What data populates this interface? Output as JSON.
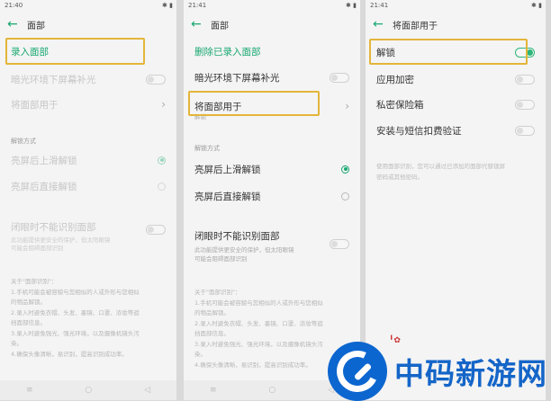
{
  "panel1": {
    "status_left": "21:40 ",
    "status_right": "",
    "title": "面部",
    "rows": {
      "enroll": "录入面部",
      "dim_fill": "暗光环境下屏幕补光",
      "use_face_for": "将面部用于"
    },
    "section_unlock": "解锁方式",
    "unlock_swipe": "亮屏后上滑解锁",
    "unlock_direct": "亮屏后直接解锁",
    "eyes_closed": "闭眼时不能识别面部",
    "eyes_closed_sub_1": "此功能提供更安全的保护，但太阳眼镜",
    "eyes_closed_sub_2": "可能会阻碍面部识别",
    "about_title": "关于\"面部识别\"：",
    "about_lines": [
      "1.手机可能会被容貌与您相似的人或外形与您相似",
      "的物品解锁。",
      "2.录入时避免衣帽、头发、墨镜、口罩、浓妆等遮",
      "挡面部信息。",
      "3.录入时避免强光、强光环境，以及摄像机镜头污",
      "染。",
      "4.确保头像清晰，易识别，提高识别成功率。"
    ]
  },
  "panel2": {
    "status_left": "21:41 ",
    "title": "面部",
    "rows": {
      "delete": "删除已录入面部",
      "dim_fill": "暗光环境下屏幕补光",
      "use_face_for": "将面部用于",
      "use_face_for_sub": "解锁"
    },
    "section_unlock": "解锁方式",
    "unlock_swipe": "亮屏后上滑解锁",
    "unlock_direct": "亮屏后直接解锁",
    "eyes_closed": "闭眼时不能识别面部",
    "eyes_closed_sub_1": "此功能提供更安全的保护，但太阳眼镜",
    "eyes_closed_sub_2": "可能会阻碍面部识别",
    "about_title": "关于\"面部识别\"：",
    "about_lines": [
      "1.手机可能会被容貌与您相似的人或外形与您相似",
      "的物品解锁。",
      "2.录入时避免衣帽、头发、墨镜、口罩、浓妆等遮",
      "挡面部信息。",
      "3.录入时避免强光、强光环境，以及摄像机镜头污",
      "染。",
      "4.确保头像清晰，易识别，提高识别成功率。"
    ]
  },
  "panel3": {
    "status_left": "21:41 ",
    "title": "将面部用于",
    "rows": {
      "unlock": "解锁",
      "app_lock": "应用加密",
      "private_safe": "私密保险箱",
      "install_verify": "安装与短信扣费验证"
    },
    "note_1": "使用面部识别，您可以通过已添加的面部代替锁屏",
    "note_2": "密码或其他密码。"
  },
  "watermark": {
    "text": "中码新游网"
  },
  "colors": {
    "accent": "#19a870",
    "highlight": "#e3b53a",
    "watermark": "#1465c8"
  }
}
